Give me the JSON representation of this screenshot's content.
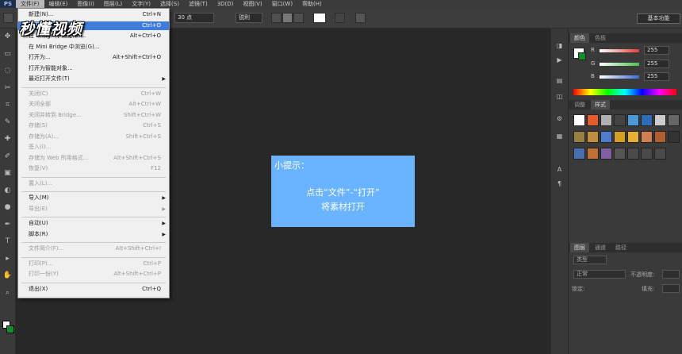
{
  "app": {
    "logo": "PS"
  },
  "menubar": [
    "文件(F)",
    "编辑(E)",
    "图像(I)",
    "图层(L)",
    "文字(Y)",
    "选择(S)",
    "滤镜(T)",
    "3D(D)",
    "视图(V)",
    "窗口(W)",
    "帮助(H)"
  ],
  "options": {
    "font_size": "30 点",
    "aa_mode": "锐利"
  },
  "workspace": "基本功能",
  "watermark": "秒懂视频",
  "file_menu": [
    {
      "label": "新建(N)...",
      "shortcut": "Ctrl+N"
    },
    {
      "label": "打开(O)...",
      "shortcut": "Ctrl+O",
      "highlight": true
    },
    {
      "label": "在 Bridge 中浏览(B)...",
      "shortcut": "Alt+Ctrl+O"
    },
    {
      "label": "在 Mini Bridge 中浏览(G)..."
    },
    {
      "label": "打开为...",
      "shortcut": "Alt+Shift+Ctrl+O"
    },
    {
      "label": "打开为智能对象..."
    },
    {
      "label": "最近打开文件(T)",
      "submenu": true
    },
    {
      "sep": true
    },
    {
      "label": "关闭(C)",
      "shortcut": "Ctrl+W",
      "disabled": true
    },
    {
      "label": "关闭全部",
      "shortcut": "Alt+Ctrl+W",
      "disabled": true
    },
    {
      "label": "关闭并转到 Bridge...",
      "shortcut": "Shift+Ctrl+W",
      "disabled": true
    },
    {
      "label": "存储(S)",
      "shortcut": "Ctrl+S",
      "disabled": true
    },
    {
      "label": "存储为(A)...",
      "shortcut": "Shift+Ctrl+S",
      "disabled": true
    },
    {
      "label": "签入(I)...",
      "disabled": true
    },
    {
      "label": "存储为 Web 所用格式...",
      "shortcut": "Alt+Shift+Ctrl+S",
      "disabled": true
    },
    {
      "label": "恢复(V)",
      "shortcut": "F12",
      "disabled": true
    },
    {
      "sep": true
    },
    {
      "label": "置入(L)...",
      "disabled": true
    },
    {
      "sep": true
    },
    {
      "label": "导入(M)",
      "submenu": true
    },
    {
      "label": "导出(E)",
      "submenu": true,
      "disabled": true
    },
    {
      "sep": true
    },
    {
      "label": "自动(U)",
      "submenu": true
    },
    {
      "label": "脚本(R)",
      "submenu": true
    },
    {
      "sep": true
    },
    {
      "label": "文件简介(F)...",
      "shortcut": "Alt+Shift+Ctrl+I",
      "disabled": true
    },
    {
      "sep": true
    },
    {
      "label": "打印(P)...",
      "shortcut": "Ctrl+P",
      "disabled": true
    },
    {
      "label": "打印一份(Y)",
      "shortcut": "Alt+Shift+Ctrl+P",
      "disabled": true
    },
    {
      "sep": true
    },
    {
      "label": "退出(X)",
      "shortcut": "Ctrl+Q"
    }
  ],
  "tip": {
    "title": "小提示：",
    "line1": "点击“文件”-“打开”",
    "line2": "将素材打开"
  },
  "color_panel": {
    "tabs": [
      "颜色",
      "色板"
    ],
    "channels": [
      {
        "label": "R",
        "value": "255",
        "color": "#e0413a"
      },
      {
        "label": "G",
        "value": "255",
        "color": "#4ac14a"
      },
      {
        "label": "B",
        "value": "255",
        "color": "#3c6cd6"
      }
    ]
  },
  "styles_panel": {
    "tabs": [
      "调整",
      "样式"
    ]
  },
  "layers_panel": {
    "tabs": [
      "图层",
      "通道",
      "路径"
    ],
    "kind": "类型",
    "blend": "正常",
    "opacity_label": "不透明度:",
    "lock_label": "锁定:",
    "fill_label": "填充:"
  }
}
